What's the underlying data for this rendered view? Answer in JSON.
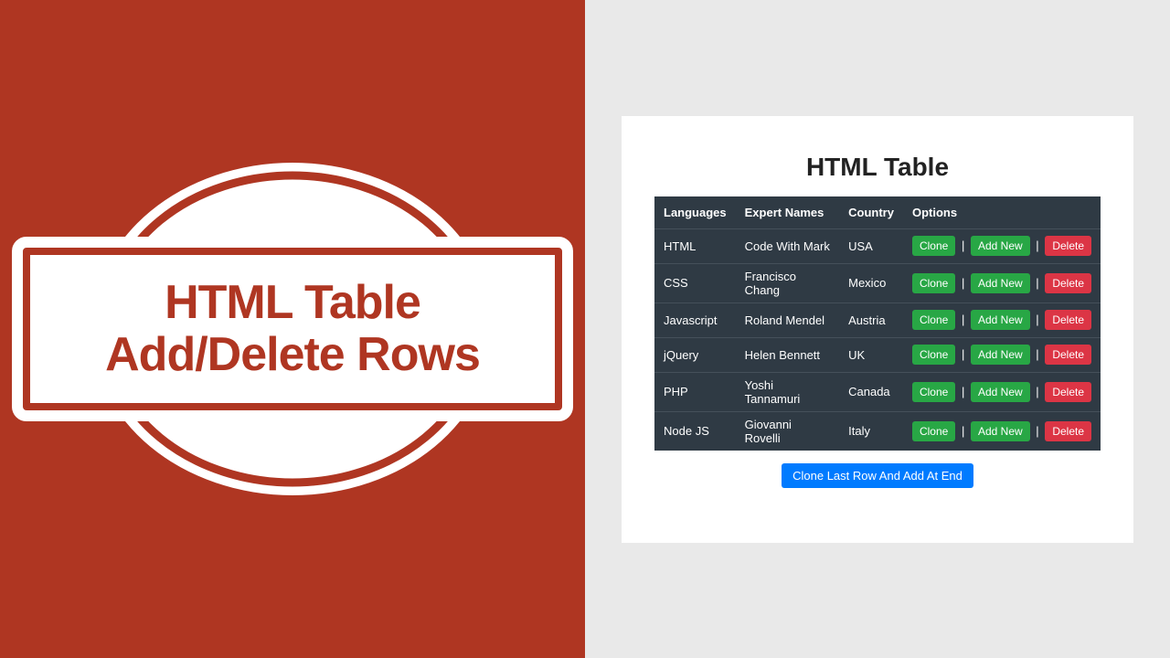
{
  "left": {
    "title_line1": "HTML Table",
    "title_line2": "Add/Delete Rows"
  },
  "card": {
    "title": "HTML Table",
    "columns": [
      "Languages",
      "Expert Names",
      "Country",
      "Options"
    ],
    "rows": [
      {
        "language": "HTML",
        "expert": "Code With Mark",
        "country": "USA"
      },
      {
        "language": "CSS",
        "expert": "Francisco Chang",
        "country": "Mexico"
      },
      {
        "language": "Javascript",
        "expert": "Roland Mendel",
        "country": "Austria"
      },
      {
        "language": "jQuery",
        "expert": "Helen Bennett",
        "country": "UK"
      },
      {
        "language": "PHP",
        "expert": "Yoshi Tannamuri",
        "country": "Canada"
      },
      {
        "language": "Node JS",
        "expert": "Giovanni Rovelli",
        "country": "Italy"
      }
    ],
    "buttons": {
      "clone": "Clone",
      "add_new": "Add New",
      "delete": "Delete",
      "separator": "|"
    },
    "footer_button": "Clone Last Row And Add At End"
  },
  "colors": {
    "brand_red": "#af3622",
    "table_bg": "#2f3a44",
    "success": "#28a745",
    "danger": "#dc3545",
    "primary": "#007bff"
  }
}
